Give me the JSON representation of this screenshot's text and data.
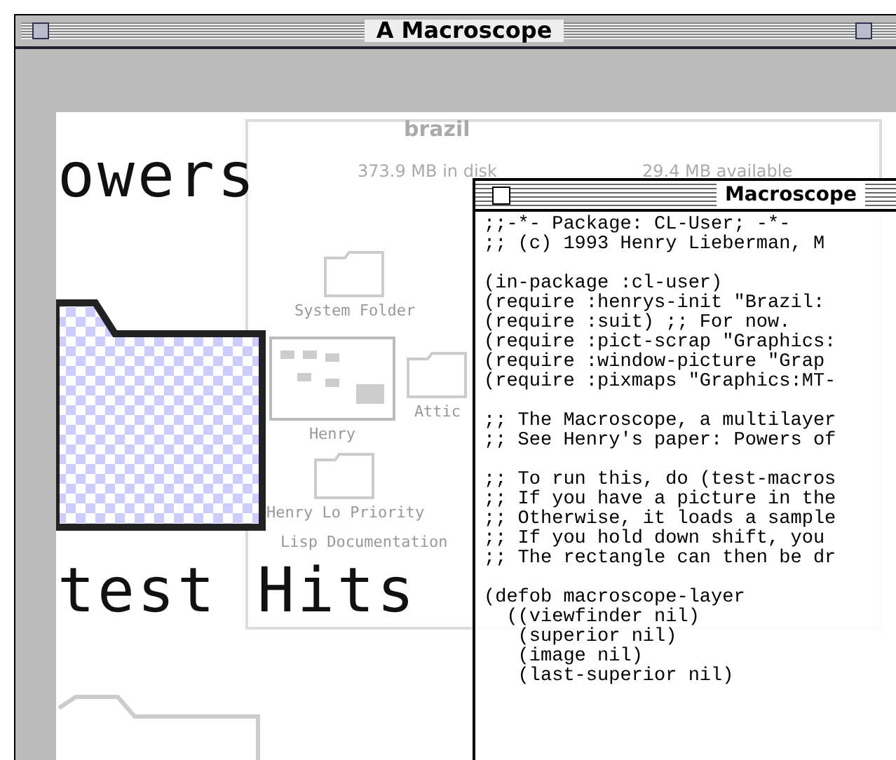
{
  "window": {
    "title": "A Macroscope"
  },
  "background_finder": {
    "title": "brazil",
    "disk_used": "373.9 MB in disk",
    "available": "29.4 MB available",
    "items": [
      {
        "label": "System Folder",
        "kind": "folder"
      },
      {
        "label": "Henry",
        "kind": "window"
      },
      {
        "label": "Attic",
        "kind": "folder"
      },
      {
        "label": "Henry Lo Priority",
        "kind": "folder"
      },
      {
        "label": "Lisp Documentation",
        "kind": "text"
      }
    ]
  },
  "slide_text": [
    "owers",
    "test Hits"
  ],
  "code_window": {
    "title": "Macroscope",
    "blocks": [
      [
        ";;-*- Package: CL-User; -*-",
        ";; (c) 1993 Henry Lieberman, M"
      ],
      [
        "(in-package :cl-user)",
        "(require :henrys-init \"Brazil:",
        "(require :suit) ;; For now.",
        "(require :pict-scrap \"Graphics:",
        "(require :window-picture \"Grap",
        "(require :pixmaps \"Graphics:MT-"
      ],
      [
        ";; The Macroscope, a multilayer",
        ";; See Henry's paper: Powers of"
      ],
      [
        ";; To run this, do (test-macros",
        ";; If you have a picture in the",
        ";; Otherwise, it loads a sample",
        ";; If you hold down shift, you",
        ";; The rectangle can then be dr"
      ],
      [
        "(defob macroscope-layer",
        "  ((viewfinder nil)",
        "   (superior nil)",
        "   (image nil)",
        "   (last-superior nil)"
      ]
    ]
  }
}
